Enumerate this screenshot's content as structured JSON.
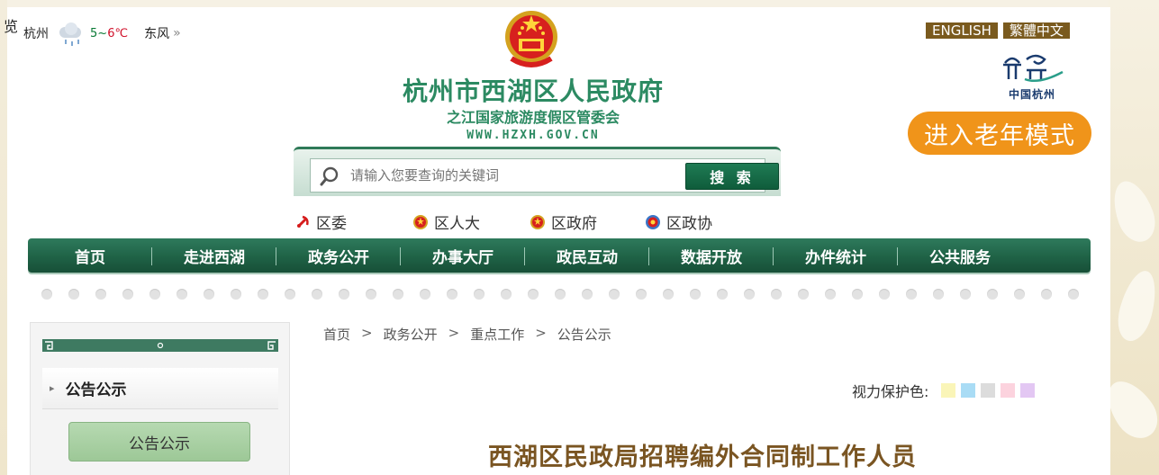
{
  "corner_glyph": "览",
  "weather": {
    "city": "杭州",
    "temp_low": "5",
    "temp_sep": "~",
    "temp_high": "6",
    "temp_unit": "℃",
    "wind": "东风",
    "chevron": "»"
  },
  "lang_links": [
    "ENGLISH",
    "繁體中文"
  ],
  "city_logo": {
    "icon": "hangzhou-city-logo",
    "text": "中国杭州"
  },
  "elder_mode_label": "进入老年模式",
  "site": {
    "title": "杭州市西湖区人民政府",
    "subtitle": "之江国家旅游度假区管委会",
    "url": "WWW.HZXH.GOV.CN"
  },
  "search": {
    "placeholder": "请输入您要查询的关键词",
    "button_label": "搜 索"
  },
  "quick_links": [
    {
      "label": "区委",
      "icon": "party-emblem-icon"
    },
    {
      "label": "区人大",
      "icon": "national-emblem-icon"
    },
    {
      "label": "区政府",
      "icon": "national-emblem-icon"
    },
    {
      "label": "区政协",
      "icon": "cppcc-emblem-icon"
    }
  ],
  "nav": [
    "首页",
    "走进西湖",
    "政务公开",
    "办事大厅",
    "政民互动",
    "数据开放",
    "办件统计",
    "公共服务"
  ],
  "sidebar": {
    "heading": "公告公示",
    "items": [
      "公告公示"
    ]
  },
  "breadcrumb": [
    "首页",
    "政务公开",
    "重点工作",
    "公告公示"
  ],
  "breadcrumb_sep": ">",
  "eye_care": {
    "label": "视力保护色:",
    "colors": [
      "#faf5b8",
      "#a9dcf5",
      "#dcdcdc",
      "#fcd3de",
      "#e3c7f3"
    ]
  },
  "article_title": "西湖区民政局招聘编外合同制工作人员",
  "colors": {
    "brand_green": "#2c8a62",
    "nav_green": "#1f6246",
    "elder_orange": "#f0941a",
    "lang_brown": "#7a5a1e",
    "title_brown": "#7a5522"
  }
}
